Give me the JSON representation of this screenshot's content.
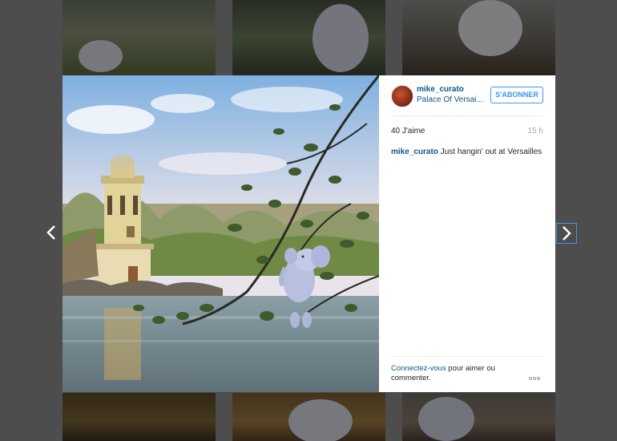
{
  "post": {
    "username": "mike_curato",
    "location": "Palace Of Versai...",
    "follow_label": "S'ABONNER",
    "likes": "40 J'aime",
    "time": "15 h",
    "caption_user": "mike_curato",
    "caption_text": " Just hangin' out at Versailles"
  },
  "footer": {
    "login_link": "Connectez-vous",
    "login_text": " pour aimer ou commenter."
  },
  "nav": {
    "prev_icon": "chevron-left-icon",
    "next_icon": "chevron-right-icon"
  },
  "colors": {
    "link": "#125688",
    "accent": "#3897f0",
    "overlay": "#4d4d4d"
  }
}
